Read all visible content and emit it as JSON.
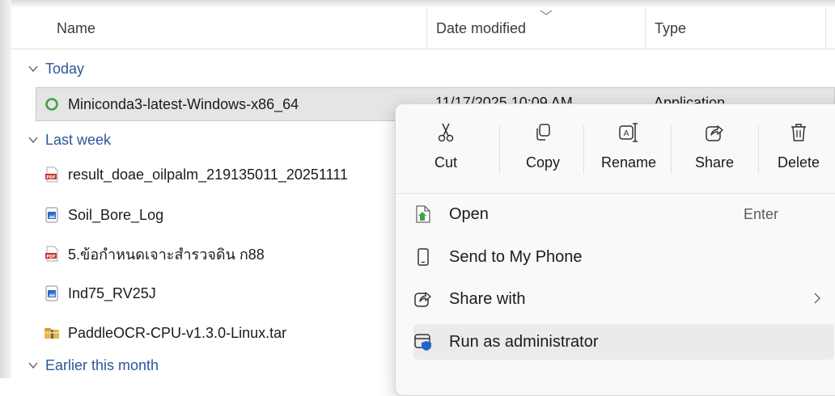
{
  "columns": {
    "name": "Name",
    "date_modified": "Date modified",
    "type": "Type"
  },
  "groups": {
    "today": "Today",
    "last_week": "Last week",
    "earlier_this_month": "Earlier this month"
  },
  "selected_file": {
    "name": "Miniconda3-latest-Windows-x86_64",
    "date": "11/17/2025 10:09 AM",
    "type": "Application",
    "icon": "installer-icon"
  },
  "files_last_week": [
    {
      "name": "result_doae_oilpalm_219135011_20251111",
      "icon": "pdf-icon"
    },
    {
      "name": "Soil_Bore_Log",
      "icon": "image-icon"
    },
    {
      "name": "5.ข้อกำหนดเจาะสำรวจดิน ก88",
      "icon": "pdf-icon"
    },
    {
      "name": "Ind75_RV25J",
      "icon": "image-icon"
    },
    {
      "name": "PaddleOCR-CPU-v1.3.0-Linux.tar",
      "icon": "archive-icon"
    }
  ],
  "context_menu": {
    "quick_actions": [
      {
        "label": "Cut",
        "icon": "scissors-icon"
      },
      {
        "label": "Copy",
        "icon": "copy-icon"
      },
      {
        "label": "Rename",
        "icon": "rename-icon"
      },
      {
        "label": "Share",
        "icon": "share-icon"
      },
      {
        "label": "Delete",
        "icon": "trash-icon"
      }
    ],
    "items": [
      {
        "label": "Open",
        "shortcut": "Enter",
        "icon": "open-icon"
      },
      {
        "label": "Send to My Phone",
        "icon": "phone-icon"
      },
      {
        "label": "Share with",
        "icon": "share-with-icon",
        "has_submenu": true
      },
      {
        "label": "Run as administrator",
        "icon": "shield-icon"
      }
    ]
  },
  "colors": {
    "accent": "#2b579a",
    "pdf_red": "#c9302c",
    "selection": "#e5e5e5"
  }
}
